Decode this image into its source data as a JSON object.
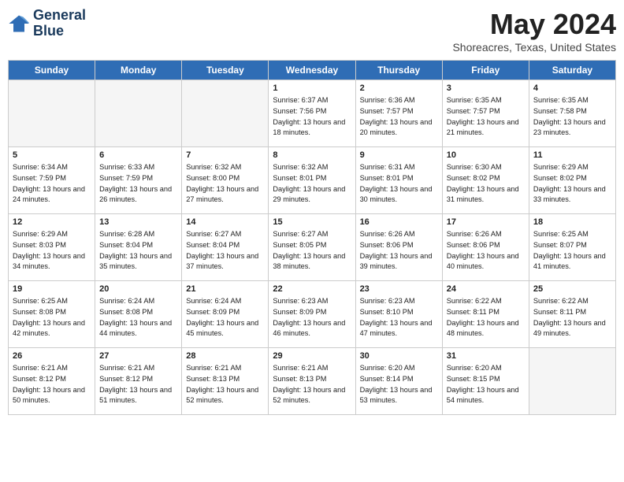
{
  "logo": {
    "line1": "General",
    "line2": "Blue"
  },
  "title": "May 2024",
  "location": "Shoreacres, Texas, United States",
  "days_of_week": [
    "Sunday",
    "Monday",
    "Tuesday",
    "Wednesday",
    "Thursday",
    "Friday",
    "Saturday"
  ],
  "weeks": [
    [
      {
        "day": "",
        "info": ""
      },
      {
        "day": "",
        "info": ""
      },
      {
        "day": "",
        "info": ""
      },
      {
        "day": "1",
        "sunrise": "Sunrise: 6:37 AM",
        "sunset": "Sunset: 7:56 PM",
        "daylight": "Daylight: 13 hours and 18 minutes."
      },
      {
        "day": "2",
        "sunrise": "Sunrise: 6:36 AM",
        "sunset": "Sunset: 7:57 PM",
        "daylight": "Daylight: 13 hours and 20 minutes."
      },
      {
        "day": "3",
        "sunrise": "Sunrise: 6:35 AM",
        "sunset": "Sunset: 7:57 PM",
        "daylight": "Daylight: 13 hours and 21 minutes."
      },
      {
        "day": "4",
        "sunrise": "Sunrise: 6:35 AM",
        "sunset": "Sunset: 7:58 PM",
        "daylight": "Daylight: 13 hours and 23 minutes."
      }
    ],
    [
      {
        "day": "5",
        "sunrise": "Sunrise: 6:34 AM",
        "sunset": "Sunset: 7:59 PM",
        "daylight": "Daylight: 13 hours and 24 minutes."
      },
      {
        "day": "6",
        "sunrise": "Sunrise: 6:33 AM",
        "sunset": "Sunset: 7:59 PM",
        "daylight": "Daylight: 13 hours and 26 minutes."
      },
      {
        "day": "7",
        "sunrise": "Sunrise: 6:32 AM",
        "sunset": "Sunset: 8:00 PM",
        "daylight": "Daylight: 13 hours and 27 minutes."
      },
      {
        "day": "8",
        "sunrise": "Sunrise: 6:32 AM",
        "sunset": "Sunset: 8:01 PM",
        "daylight": "Daylight: 13 hours and 29 minutes."
      },
      {
        "day": "9",
        "sunrise": "Sunrise: 6:31 AM",
        "sunset": "Sunset: 8:01 PM",
        "daylight": "Daylight: 13 hours and 30 minutes."
      },
      {
        "day": "10",
        "sunrise": "Sunrise: 6:30 AM",
        "sunset": "Sunset: 8:02 PM",
        "daylight": "Daylight: 13 hours and 31 minutes."
      },
      {
        "day": "11",
        "sunrise": "Sunrise: 6:29 AM",
        "sunset": "Sunset: 8:02 PM",
        "daylight": "Daylight: 13 hours and 33 minutes."
      }
    ],
    [
      {
        "day": "12",
        "sunrise": "Sunrise: 6:29 AM",
        "sunset": "Sunset: 8:03 PM",
        "daylight": "Daylight: 13 hours and 34 minutes."
      },
      {
        "day": "13",
        "sunrise": "Sunrise: 6:28 AM",
        "sunset": "Sunset: 8:04 PM",
        "daylight": "Daylight: 13 hours and 35 minutes."
      },
      {
        "day": "14",
        "sunrise": "Sunrise: 6:27 AM",
        "sunset": "Sunset: 8:04 PM",
        "daylight": "Daylight: 13 hours and 37 minutes."
      },
      {
        "day": "15",
        "sunrise": "Sunrise: 6:27 AM",
        "sunset": "Sunset: 8:05 PM",
        "daylight": "Daylight: 13 hours and 38 minutes."
      },
      {
        "day": "16",
        "sunrise": "Sunrise: 6:26 AM",
        "sunset": "Sunset: 8:06 PM",
        "daylight": "Daylight: 13 hours and 39 minutes."
      },
      {
        "day": "17",
        "sunrise": "Sunrise: 6:26 AM",
        "sunset": "Sunset: 8:06 PM",
        "daylight": "Daylight: 13 hours and 40 minutes."
      },
      {
        "day": "18",
        "sunrise": "Sunrise: 6:25 AM",
        "sunset": "Sunset: 8:07 PM",
        "daylight": "Daylight: 13 hours and 41 minutes."
      }
    ],
    [
      {
        "day": "19",
        "sunrise": "Sunrise: 6:25 AM",
        "sunset": "Sunset: 8:08 PM",
        "daylight": "Daylight: 13 hours and 42 minutes."
      },
      {
        "day": "20",
        "sunrise": "Sunrise: 6:24 AM",
        "sunset": "Sunset: 8:08 PM",
        "daylight": "Daylight: 13 hours and 44 minutes."
      },
      {
        "day": "21",
        "sunrise": "Sunrise: 6:24 AM",
        "sunset": "Sunset: 8:09 PM",
        "daylight": "Daylight: 13 hours and 45 minutes."
      },
      {
        "day": "22",
        "sunrise": "Sunrise: 6:23 AM",
        "sunset": "Sunset: 8:09 PM",
        "daylight": "Daylight: 13 hours and 46 minutes."
      },
      {
        "day": "23",
        "sunrise": "Sunrise: 6:23 AM",
        "sunset": "Sunset: 8:10 PM",
        "daylight": "Daylight: 13 hours and 47 minutes."
      },
      {
        "day": "24",
        "sunrise": "Sunrise: 6:22 AM",
        "sunset": "Sunset: 8:11 PM",
        "daylight": "Daylight: 13 hours and 48 minutes."
      },
      {
        "day": "25",
        "sunrise": "Sunrise: 6:22 AM",
        "sunset": "Sunset: 8:11 PM",
        "daylight": "Daylight: 13 hours and 49 minutes."
      }
    ],
    [
      {
        "day": "26",
        "sunrise": "Sunrise: 6:21 AM",
        "sunset": "Sunset: 8:12 PM",
        "daylight": "Daylight: 13 hours and 50 minutes."
      },
      {
        "day": "27",
        "sunrise": "Sunrise: 6:21 AM",
        "sunset": "Sunset: 8:12 PM",
        "daylight": "Daylight: 13 hours and 51 minutes."
      },
      {
        "day": "28",
        "sunrise": "Sunrise: 6:21 AM",
        "sunset": "Sunset: 8:13 PM",
        "daylight": "Daylight: 13 hours and 52 minutes."
      },
      {
        "day": "29",
        "sunrise": "Sunrise: 6:21 AM",
        "sunset": "Sunset: 8:13 PM",
        "daylight": "Daylight: 13 hours and 52 minutes."
      },
      {
        "day": "30",
        "sunrise": "Sunrise: 6:20 AM",
        "sunset": "Sunset: 8:14 PM",
        "daylight": "Daylight: 13 hours and 53 minutes."
      },
      {
        "day": "31",
        "sunrise": "Sunrise: 6:20 AM",
        "sunset": "Sunset: 8:15 PM",
        "daylight": "Daylight: 13 hours and 54 minutes."
      },
      {
        "day": "",
        "info": ""
      }
    ]
  ]
}
